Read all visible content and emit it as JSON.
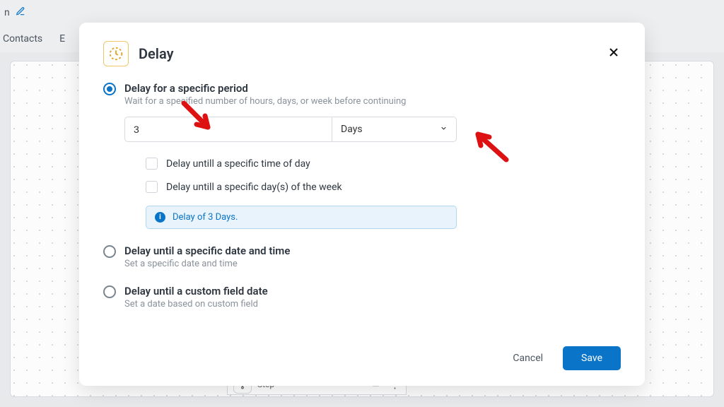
{
  "background": {
    "header_fragment": "n",
    "nav": {
      "item1": "Contacts",
      "item2_fragment": "E"
    },
    "step": {
      "label": "Step"
    }
  },
  "modal": {
    "title": "Delay",
    "option1": {
      "title": "Delay for a specific period",
      "desc": "Wait for a specified number of hours, days, or week before continuing",
      "value": "3",
      "unit": "Days",
      "check1": "Delay untill a specific time of day",
      "check2": "Delay untill a specific day(s) of the week",
      "info": "Delay of 3 Days."
    },
    "option2": {
      "title": "Delay until a specific date and time",
      "desc": "Set a specific date and time"
    },
    "option3": {
      "title": "Delay until a custom field date",
      "desc": "Set a date based on custom field"
    },
    "cancel": "Cancel",
    "save": "Save"
  }
}
